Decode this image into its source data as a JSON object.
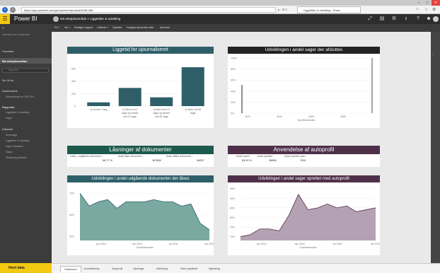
{
  "browser": {
    "url": "https://app.powerbi.com/groups/me/reports/a9e1f8-4b8...",
    "tab_title": "Liggetider & udvikling - Powe...",
    "search_hint": "ρ - ☰ C"
  },
  "header": {
    "app_name": "Power BI",
    "workspace": "Mit arbejdsområde > Liggetider & udvikling"
  },
  "toolbar": {
    "items": [
      "Fil ˅",
      "Vis ˅",
      "Rediger rapport",
      "Udforsk ˅",
      "Opdater",
      "Fastgør dynamisk side",
      "Abonner"
    ]
  },
  "sidebar": {
    "favorites": "Favoritter",
    "workspace": "Mit arbejdsområde",
    "search_placeholder": "Søg efter",
    "recent": "Nu: til vis",
    "dashboards": "Dashboards",
    "dashboard_items": [
      "Rekruttering fra CSA CFK"
    ],
    "reports": "Rapporter",
    "report_items": [
      "Liggetider & udvikling",
      "Sager"
    ],
    "datasets": "Datasæt",
    "dataset_items": [
      "Ansvarlige",
      "Liggetider & udvikling",
      "Sager Standard",
      "Status",
      "Streaming datasæt"
    ],
    "get_data": "Hent data",
    "top_item": "Oversæt over Dashboard"
  },
  "bottom_tabs": [
    "Dashboard",
    "Journalisering",
    "Autoprofil",
    "Låsninger",
    "Afslutning",
    "Sidst opdateret",
    "Nyjobbing"
  ],
  "colors": {
    "dark_teal": "#2e5f69",
    "dark_blue": "#253f4c",
    "dark_green": "#1d5a4d",
    "purple": "#4e3049",
    "teal_area": "#7aa9a2",
    "purple_area": "#b5a1b4",
    "black_title": "#222222"
  },
  "chart1": {
    "title": "Liggetid for ujournaliseret",
    "chart_data": {
      "type": "bar",
      "categories": [
        "1) mindre 2 dag",
        "2) Mere end 2 dage og mindre end 14 dage",
        "3) Mere end 14 dage og mindre end 30 dage",
        "4) Mere end 30 dage"
      ],
      "values": [
        60,
        290,
        140,
        620
      ],
      "ylim": [
        0,
        700
      ],
      "yticks": [
        "0",
        "200",
        "400",
        "600"
      ]
    }
  },
  "chart2": {
    "title": "Udviklingen i andel sager der afsluttes",
    "chart_data": {
      "type": "line",
      "xlabel": "Oprettelsesdato",
      "xticks": [
        "2020",
        "2040",
        "2060",
        "2080"
      ],
      "yticks": [
        "0%",
        "20%",
        "40%",
        "60%",
        "80%",
        "100%"
      ]
    }
  },
  "card1": {
    "title": "Låsninger af dokumenter",
    "headers": [
      "Låste - udgående dokument...",
      "Antal låste dokument...",
      "Antal ulåste dokument..."
    ],
    "values": [
      "66,77 %",
      "187828",
      "94057"
    ]
  },
  "card2": {
    "title": "Anvendelse af autoprofil",
    "headers": [
      "Andel opret...",
      "Antal oprettet",
      "Antal oprettet uden"
    ],
    "values": [
      "83,99 %",
      "36896",
      "7004"
    ]
  },
  "chart3": {
    "title": "Udviklingen i andel udgående dokumenter der låses",
    "chart_data": {
      "type": "area",
      "xlabel": "Oprettelsesdato",
      "xticks": [
        "jan 2016",
        "apr 2016",
        "jul 2016",
        "okt 2016"
      ],
      "yticks": [
        "50%",
        "60%",
        "70%"
      ],
      "values": [
        70,
        64,
        66,
        67,
        63,
        66,
        66,
        66,
        67,
        66,
        66,
        64,
        65,
        56,
        53
      ]
    }
  },
  "chart4": {
    "title": "Udviklingen i andel sager oprettet med autoprofil",
    "chart_data": {
      "type": "area",
      "xlabel": "Oprettelsesdato",
      "xticks": [
        "jan 2016",
        "apr 2016",
        "jul 2016",
        "okt 2016"
      ],
      "yticks": [
        "70%",
        "75%",
        "80%",
        "85%",
        "90%",
        "95%"
      ],
      "values": [
        70,
        71,
        74,
        74,
        73,
        81,
        92,
        84,
        85,
        87,
        85,
        86,
        83,
        84,
        85
      ]
    }
  }
}
